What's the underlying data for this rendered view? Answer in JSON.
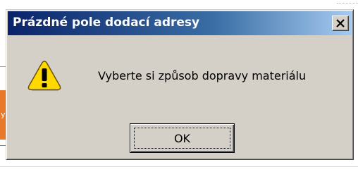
{
  "dialog": {
    "title": "Prázdné pole dodací adresy",
    "message": "Vyberte si způsob dopravy materiálu",
    "icon": "warning-icon",
    "ok_label": "OK",
    "close_icon": "close-icon"
  },
  "colors": {
    "titlebar_start": "#0a246a",
    "titlebar_end": "#a6caf0",
    "dialog_face": "#d4d0c8",
    "warning_yellow": "#ffd800",
    "background_accent": "#e8782a"
  }
}
